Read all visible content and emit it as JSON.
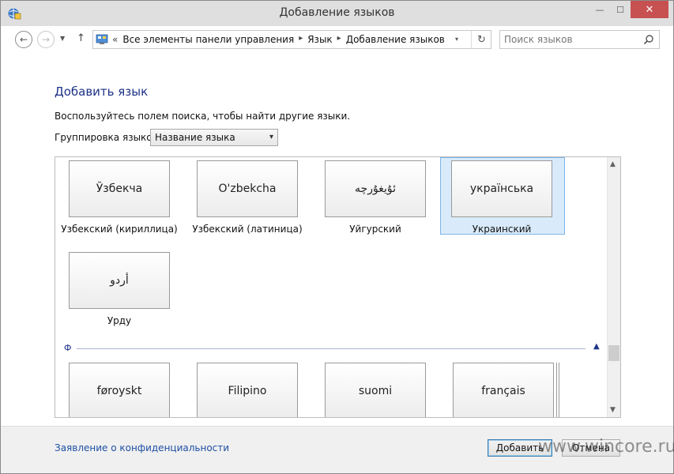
{
  "window": {
    "title": "Добавление языков",
    "minimize_glyph": "—",
    "maximize_glyph": "☐",
    "close_glyph": "✕"
  },
  "nav": {
    "back_glyph": "←",
    "forward_glyph": "→",
    "dropdown_glyph": "▼",
    "up_glyph": "↑"
  },
  "address": {
    "prefix": "«",
    "crumbs": [
      "Все элементы панели управления",
      "Язык",
      "Добавление языков"
    ],
    "separator": "▸",
    "dropdown_glyph": "▾",
    "refresh_glyph": "↻"
  },
  "search": {
    "placeholder": "Поиск языков"
  },
  "page": {
    "heading": "Добавить язык",
    "description": "Воспользуйтесь полем поиска, чтобы найти другие языки.",
    "group_label": "Группировка языков:",
    "group_value": "Название языка",
    "group_arrow": "▾"
  },
  "languages_u": [
    {
      "native": "Ўзбекча",
      "name": "Узбекский (кириллица)",
      "selected": false
    },
    {
      "native": "O'zbekcha",
      "name": "Узбекский (латиница)",
      "selected": false
    },
    {
      "native": "ئۇيغۇرچە",
      "name": "Уйгурский",
      "selected": false
    },
    {
      "native": "українська",
      "name": "Украинский",
      "selected": true
    },
    {
      "native": "أردو",
      "name": "Урду",
      "selected": false
    }
  ],
  "section_f": {
    "letter": "Ф",
    "collapse_glyph": "▲"
  },
  "languages_f": [
    {
      "native": "føroyskt"
    },
    {
      "native": "Filipino"
    },
    {
      "native": "suomi"
    },
    {
      "native": "français"
    }
  ],
  "scrollbar": {
    "up_glyph": "▲",
    "down_glyph": "▼"
  },
  "footer": {
    "privacy_link": "Заявление о конфиденциальности",
    "add_button": "Добавить",
    "cancel_button": "Отмена",
    "watermark": "www.wincore.ru"
  },
  "colors": {
    "accent": "#1e3287",
    "link": "#1e4fa3",
    "selection_bg": "#d9ebfb",
    "selection_border": "#7eb4ea",
    "close_button": "#c75050"
  }
}
